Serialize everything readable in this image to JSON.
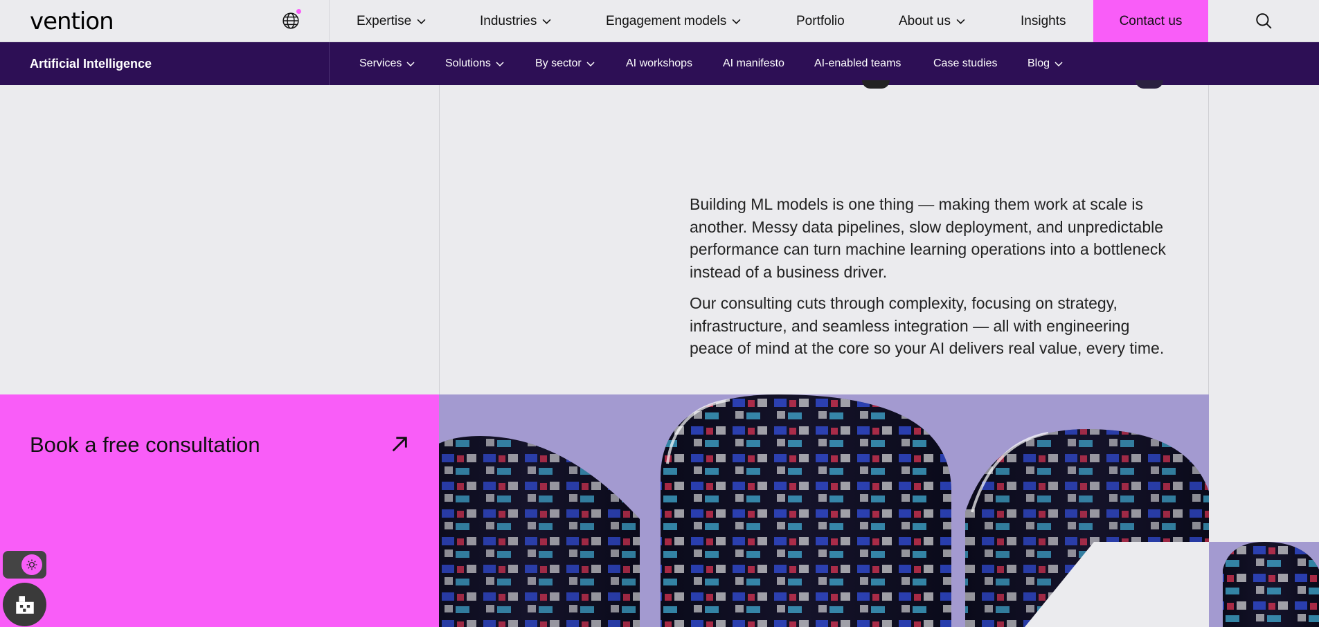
{
  "header": {
    "logo_text": "vention",
    "nav": [
      {
        "label": "Expertise",
        "has_menu": true
      },
      {
        "label": "Industries",
        "has_menu": true
      },
      {
        "label": "Engagement models",
        "has_menu": true
      },
      {
        "label": "Portfolio",
        "has_menu": false
      },
      {
        "label": "About us",
        "has_menu": true
      },
      {
        "label": "Insights",
        "has_menu": false
      }
    ],
    "contact_label": "Contact us",
    "icons": {
      "language": "globe-icon",
      "search": "search-icon",
      "chevron": "chevron-down-icon"
    }
  },
  "subnav": {
    "section_title": "Artificial Intelligence",
    "items": [
      {
        "label": "Services",
        "has_menu": true
      },
      {
        "label": "Solutions",
        "has_menu": true
      },
      {
        "label": "By sector",
        "has_menu": true
      },
      {
        "label": "AI workshops",
        "has_menu": false
      },
      {
        "label": "AI manifesto",
        "has_menu": false
      },
      {
        "label": "AI-enabled teams",
        "has_menu": false
      },
      {
        "label": "Case studies",
        "has_menu": false
      },
      {
        "label": "Blog",
        "has_menu": true
      }
    ]
  },
  "main": {
    "paragraph1": "Building ML models is one thing — making them work at scale is another. Messy data pipelines, slow deployment, and unpredictable performance can turn machine learning operations into a bottleneck instead of a business driver.",
    "paragraph2": "Our consulting cuts through complexity, focusing on strategy, infrastructure, and seamless integration — all with engineering peace of mind at the core so your AI delivers real value, every time."
  },
  "cta": {
    "label": "Book a free consultation",
    "icon": "arrow-up-right-icon"
  },
  "widgets": {
    "theme_toggle_icon": "sun-icon",
    "accessibility_icon": "accessibility-icon"
  },
  "colors": {
    "accent": "#f95df8",
    "subnav_bg": "#2d0f55",
    "page_bg": "#ebebee"
  }
}
